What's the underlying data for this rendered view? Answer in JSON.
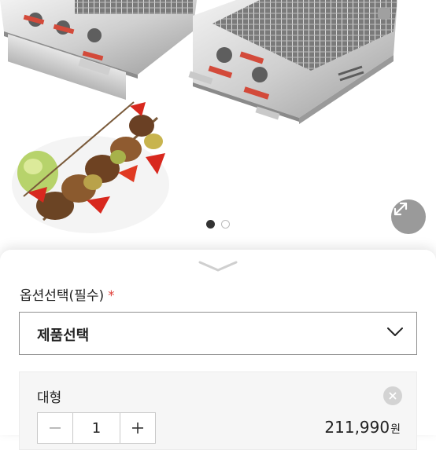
{
  "gallery": {
    "image_description_icon": "bbq-grill-and-kebab-photo-icon",
    "slide_count": 2,
    "active_slide": 1,
    "expand_icon": "expand-arrows-icon"
  },
  "sheet": {
    "handle_icon": "chevron-down-icon"
  },
  "options": {
    "label": "옵션선택(필수)",
    "required_mark": "*",
    "select_placeholder": "제품선택",
    "select_icon": "chevron-down-icon"
  },
  "selected_item": {
    "name": "대형",
    "quantity": "1",
    "price": "211,990",
    "currency": "원",
    "remove_icon": "close-icon",
    "minus_icon": "minus-icon",
    "plus_icon": "plus-icon"
  },
  "colors": {
    "required": "#e0403a",
    "active_dot": "#333333",
    "expand_button": "#9a9a9a"
  }
}
